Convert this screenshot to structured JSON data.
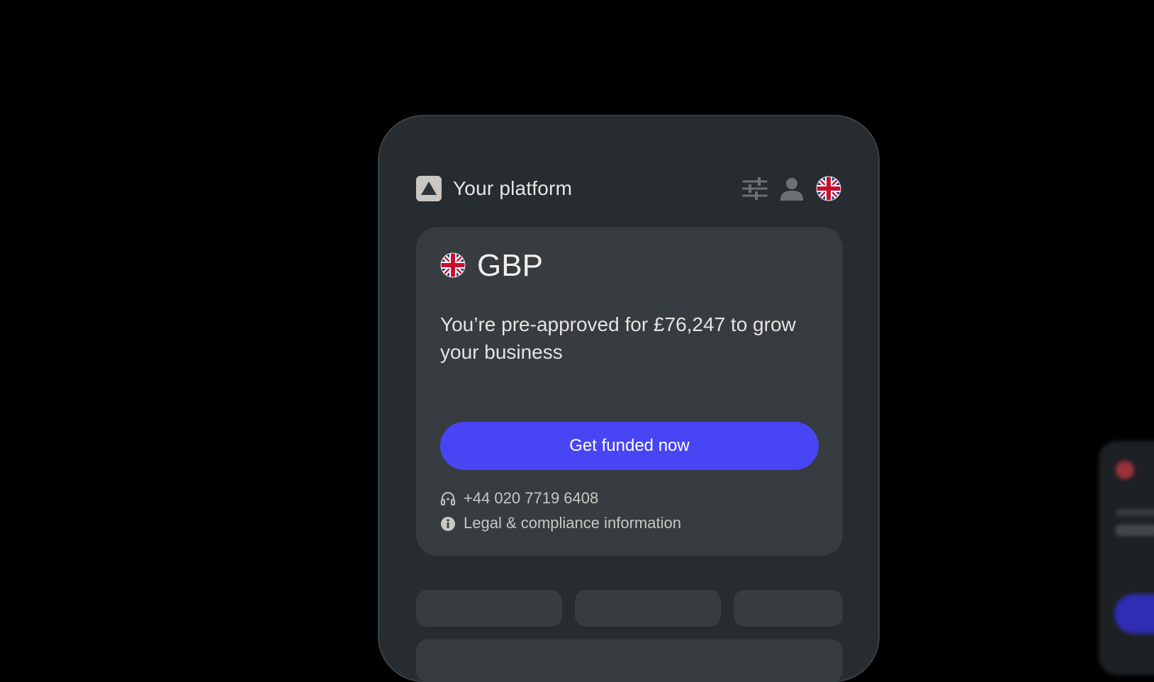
{
  "header": {
    "title": "Your platform",
    "logo_icon": "triangle-logo-icon",
    "filter_icon": "sliders-icon",
    "account_icon": "user-icon",
    "language_icon": "uk-flag-icon"
  },
  "card": {
    "currency_code": "GBP",
    "currency_flag_icon": "uk-flag-icon",
    "offer_text": "You’re pre-approved for £76,247 to grow your business",
    "cta_label": "Get funded now",
    "phone_icon": "headset-icon",
    "phone_number": "+44 020 7719 6408",
    "info_icon": "info-icon",
    "legal_link": "Legal & compliance information"
  },
  "colors": {
    "background": "#000000",
    "phone_bg": "#262c2f",
    "card_bg": "#363c3f",
    "accent": "#4845f5"
  }
}
